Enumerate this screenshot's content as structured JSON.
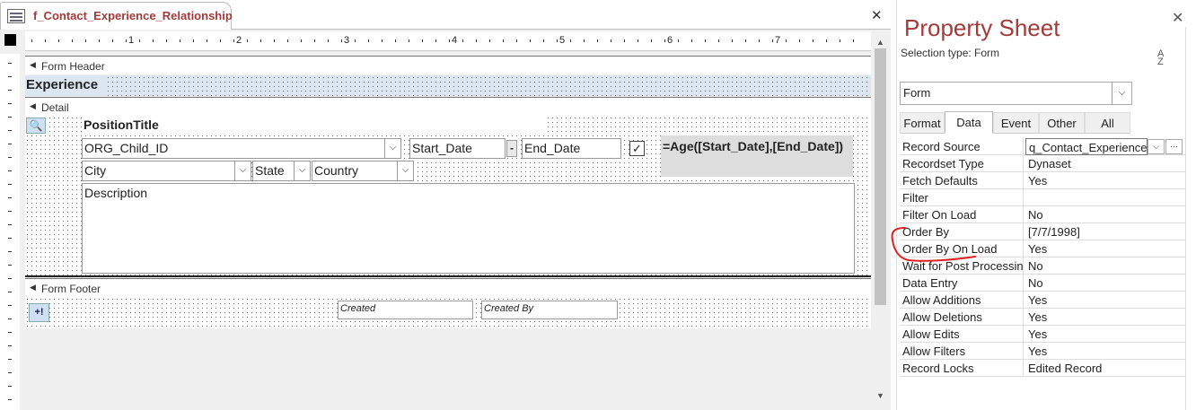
{
  "document": {
    "tab_title": "f_Contact_Experience_Relationship",
    "close_glyph": "✕"
  },
  "ruler": {
    "numbers": [
      "1",
      "2",
      "3",
      "4",
      "5",
      "6",
      "7"
    ]
  },
  "sections": {
    "header": "Form Header",
    "detail": "Detail",
    "footer": "Form Footer"
  },
  "controls": {
    "experience": "Experience",
    "position_title": "PositionTitle",
    "org_child_id": "ORG_Child_ID",
    "start_date": "Start_Date",
    "dash": "-",
    "end_date": "End_Date",
    "age_expression": "=Age([Start_Date],[End_Date])",
    "city": "City",
    "state": "State",
    "country": "Country",
    "description": "Description",
    "created": "Created",
    "created_by": "Created By"
  },
  "property_sheet": {
    "title": "Property Sheet",
    "close_glyph": "✕",
    "selection_type": "Selection type:  Form",
    "sort_glyph": "A↓Z",
    "object_combo": "Form",
    "tabs": [
      "Format",
      "Data",
      "Event",
      "Other",
      "All"
    ],
    "active_tab": "Data",
    "properties": [
      {
        "name": "Record Source",
        "value": "q_Contact_Experience_"
      },
      {
        "name": "Recordset Type",
        "value": "Dynaset"
      },
      {
        "name": "Fetch Defaults",
        "value": "Yes"
      },
      {
        "name": "Filter",
        "value": ""
      },
      {
        "name": "Filter On Load",
        "value": "No"
      },
      {
        "name": "Order By",
        "value": "[7/7/1998]"
      },
      {
        "name": "Order By On Load",
        "value": "Yes"
      },
      {
        "name": "Wait for Post Processin",
        "value": "No"
      },
      {
        "name": "Data Entry",
        "value": "No"
      },
      {
        "name": "Allow Additions",
        "value": "Yes"
      },
      {
        "name": "Allow Deletions",
        "value": "Yes"
      },
      {
        "name": "Allow Edits",
        "value": "Yes"
      },
      {
        "name": "Allow Filters",
        "value": "Yes"
      },
      {
        "name": "Record Locks",
        "value": "Edited Record"
      }
    ]
  },
  "colors": {
    "accent": "#a33a3a",
    "annotation": "#e02020",
    "section_blue": "#dce6f1"
  }
}
